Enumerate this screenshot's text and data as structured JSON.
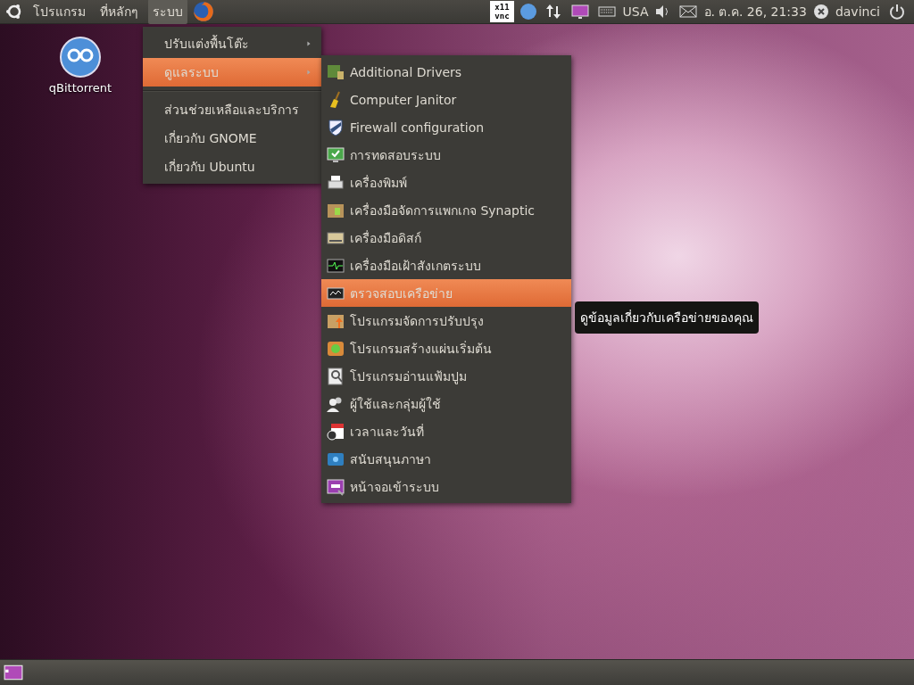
{
  "top_panel": {
    "menus": [
      {
        "label": "โปรแกรม",
        "selected": false
      },
      {
        "label": "ที่หลักๆ",
        "selected": false
      },
      {
        "label": "ระบบ",
        "selected": true
      }
    ],
    "vnc_badge": [
      "x11",
      "vnc"
    ],
    "keyboard_layout": "USA",
    "clock": "อ. ต.ค. 26, 21:33",
    "user": "davinci"
  },
  "desktop_icons": [
    {
      "label": "qBittorrent"
    }
  ],
  "system_menu": {
    "groups": [
      [
        {
          "label": "ปรับแต่งพื้นโต๊ะ",
          "has_submenu": true,
          "selected": false
        },
        {
          "label": "ดูแลระบบ",
          "has_submenu": true,
          "selected": true
        }
      ],
      [
        {
          "label": "ส่วนช่วยเหลือและบริการ",
          "has_submenu": false,
          "selected": false
        },
        {
          "label": "เกี่ยวกับ GNOME",
          "has_submenu": false,
          "selected": false
        },
        {
          "label": "เกี่ยวกับ Ubuntu",
          "has_submenu": false,
          "selected": false
        }
      ]
    ]
  },
  "administration_menu": {
    "items": [
      {
        "label": "Additional Drivers",
        "selected": false
      },
      {
        "label": "Computer Janitor",
        "selected": false
      },
      {
        "label": "Firewall configuration",
        "selected": false
      },
      {
        "label": "การทดสอบระบบ",
        "selected": false
      },
      {
        "label": "เครื่องพิมพ์",
        "selected": false
      },
      {
        "label": "เครื่องมือจัดการแพกเกจ Synaptic",
        "selected": false
      },
      {
        "label": "เครื่องมือดิสก์",
        "selected": false
      },
      {
        "label": "เครื่องมือเฝ้าสังเกตระบบ",
        "selected": false
      },
      {
        "label": "ตรวจสอบเครือข่าย",
        "selected": true
      },
      {
        "label": "โปรแกรมจัดการปรับปรุง",
        "selected": false
      },
      {
        "label": "โปรแกรมสร้างแผ่นเริ่มต้น",
        "selected": false
      },
      {
        "label": "โปรแกรมอ่านแฟ้มปูม",
        "selected": false
      },
      {
        "label": "ผู้ใช้และกลุ่มผู้ใช้",
        "selected": false
      },
      {
        "label": "เวลาและวันที่",
        "selected": false
      },
      {
        "label": "สนับสนุนภาษา",
        "selected": false
      },
      {
        "label": "หน้าจอเข้าระบบ",
        "selected": false
      }
    ]
  },
  "tooltip": {
    "text": "ดูข้อมูลเกี่ยวกับเครือข่ายของคุณ"
  }
}
